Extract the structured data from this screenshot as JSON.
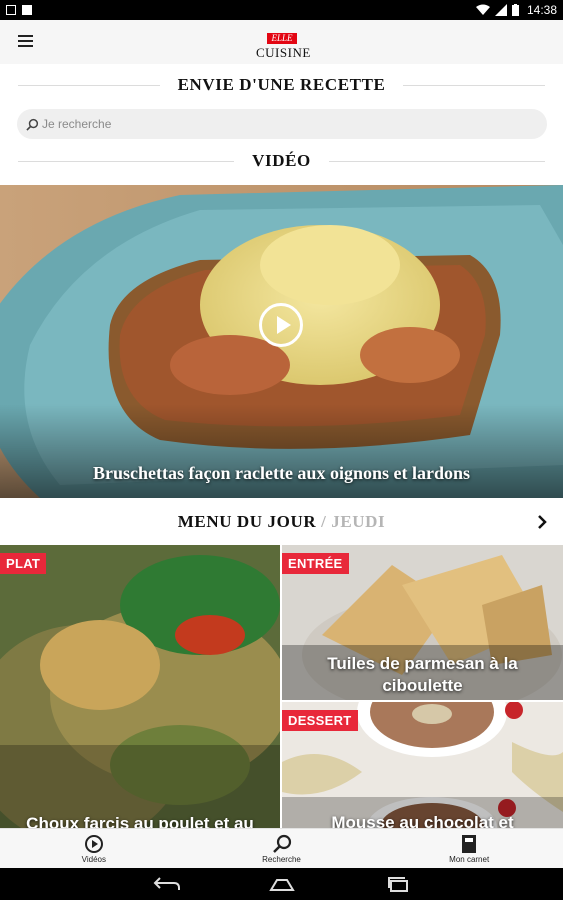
{
  "status_bar": {
    "time": "14:38"
  },
  "header": {
    "logo_badge": "ELLE",
    "logo_word": "CUISINE"
  },
  "search_section": {
    "title": "ENVIE D'UNE RECETTE",
    "placeholder": "Je recherche"
  },
  "video_section": {
    "title": "VIDÉO",
    "video_title": "Bruschettas façon raclette aux oignons et lardons"
  },
  "menu_du_jour": {
    "title": "MENU DU JOUR",
    "day": "/ JEUDI",
    "cards": [
      {
        "tag": "PLAT",
        "title": "Choux farcis au poulet et au"
      },
      {
        "tag": "ENTRÉE",
        "title": "Tuiles de parmesan à la ciboulette"
      },
      {
        "tag": "DESSERT",
        "title": "Mousse au chocolat et"
      }
    ]
  },
  "tabs": [
    {
      "label": "Vidéos",
      "icon": "play-circle-icon"
    },
    {
      "label": "Recherche",
      "icon": "search-icon"
    },
    {
      "label": "Mon carnet",
      "icon": "notebook-icon"
    }
  ],
  "colors": {
    "accent": "#e8283a",
    "logo_red": "#e30613"
  }
}
